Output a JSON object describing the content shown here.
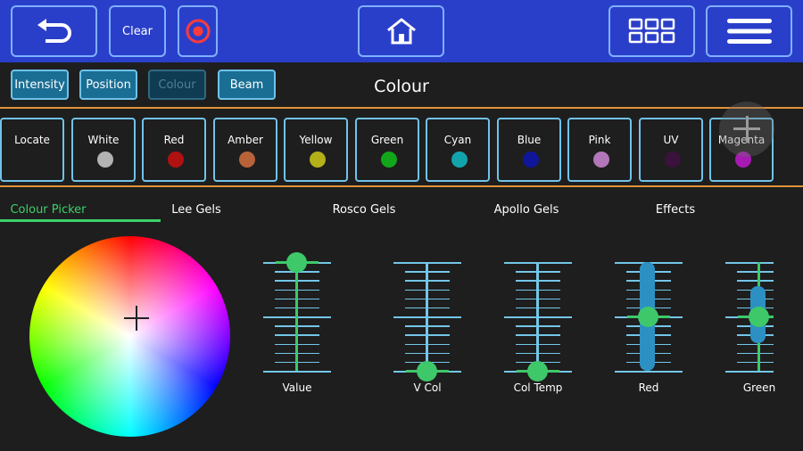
{
  "header": {
    "clear_label": "Clear"
  },
  "modes": [
    {
      "label": "Intensity",
      "active": false
    },
    {
      "label": "Position",
      "active": false
    },
    {
      "label": "Colour",
      "active": true
    },
    {
      "label": "Beam",
      "active": false
    }
  ],
  "page_title": "Colour",
  "presets": [
    {
      "label": "Locate",
      "color": null
    },
    {
      "label": "White",
      "color": "#b3b3b3"
    },
    {
      "label": "Red",
      "color": "#b01111"
    },
    {
      "label": "Amber",
      "color": "#b8623a"
    },
    {
      "label": "Yellow",
      "color": "#b3b01a"
    },
    {
      "label": "Green",
      "color": "#12a61b"
    },
    {
      "label": "Cyan",
      "color": "#12a4ad"
    },
    {
      "label": "Blue",
      "color": "#10169a"
    },
    {
      "label": "Pink",
      "color": "#b376b8"
    },
    {
      "label": "UV",
      "color": "#3a123c"
    },
    {
      "label": "Magenta",
      "color": "#a61ab3"
    }
  ],
  "tabs": [
    {
      "label": "Colour Picker",
      "active": true
    },
    {
      "label": "Lee Gels",
      "active": false
    },
    {
      "label": "Rosco Gels",
      "active": false
    },
    {
      "label": "Apollo Gels",
      "active": false
    },
    {
      "label": "Effects",
      "active": false
    }
  ],
  "faders": [
    {
      "label": "Value",
      "level": 1.0,
      "track_color": "#3ec86a",
      "style": "slider"
    },
    {
      "label": "V Col",
      "level": 0.0,
      "track_color": "#73c6e8",
      "style": "slider"
    },
    {
      "label": "Col Temp",
      "level": 0.0,
      "track_color": "#73c6e8",
      "style": "slider"
    },
    {
      "label": "Red",
      "level": 0.5,
      "track_color": "#2c90c2",
      "style": "bar",
      "bar_from": 0.0,
      "bar_to": 1.0
    },
    {
      "label": "Green",
      "level": 0.5,
      "track_color": "#3ec86a",
      "style": "bar",
      "bar_from": 0.25,
      "bar_to": 0.78
    }
  ]
}
